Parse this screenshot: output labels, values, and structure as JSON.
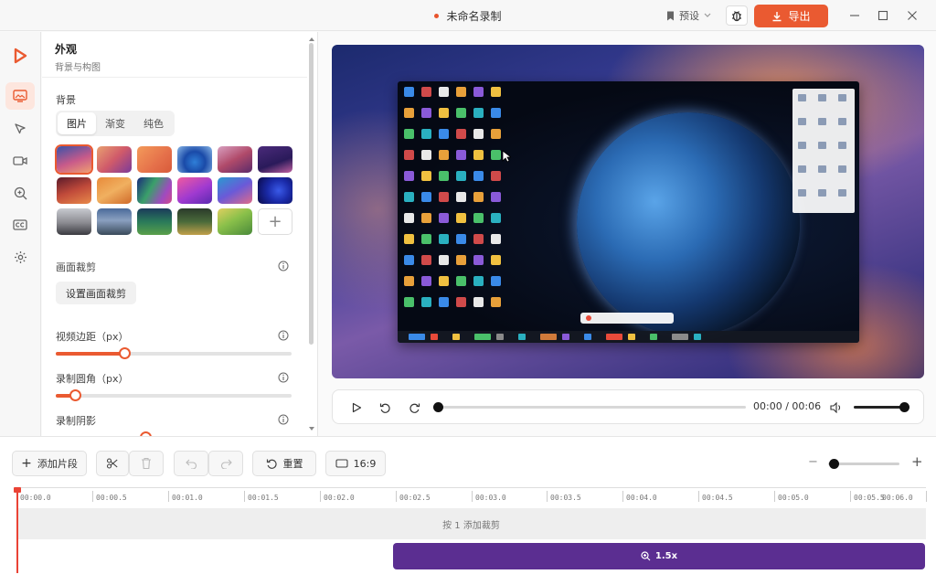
{
  "window": {
    "title": "未命名录制",
    "preset_label": "预设",
    "export_label": "导出"
  },
  "rail": {
    "items": [
      "app-logo",
      "appearance",
      "cursor",
      "camera",
      "zoom",
      "captions",
      "settings"
    ]
  },
  "panel": {
    "title": "外观",
    "subtitle": "背景与构图",
    "background_label": "背景",
    "tabs": [
      {
        "label": "图片",
        "active": true
      },
      {
        "label": "渐变",
        "active": false
      },
      {
        "label": "纯色",
        "active": false
      }
    ],
    "wallpaper_count": 17,
    "selected_wallpaper": 0,
    "crop_label": "画面裁剪",
    "crop_button": "设置画面裁剪",
    "padding_label": "视频边距（px）",
    "padding_value_fraction": 0.29,
    "radius_label": "录制圆角（px）",
    "radius_value_fraction": 0.08,
    "shadow_label": "录制阴影"
  },
  "player": {
    "time": "00:00 / 00:06",
    "progress_fraction": 0.0,
    "volume_fraction": 1.0
  },
  "toolbar": {
    "add_clip": "添加片段",
    "reset": "重置",
    "aspect_ratio": "16:9",
    "zoom_fraction": 0.05
  },
  "timeline": {
    "ticks": [
      "00:00.0",
      "00:00.5",
      "00:01.0",
      "00:01.5",
      "00:02.0",
      "00:02.5",
      "00:03.0",
      "00:03.5",
      "00:04.0",
      "00:04.5",
      "00:05.0",
      "00:05.5",
      "00:06.0"
    ],
    "cut_hint": "按 1 添加裁剪",
    "zoom_clip_label": "1.5x"
  },
  "colors": {
    "accent": "#ea5a31",
    "zoom_clip": "#5b2e91",
    "playhead": "#ea4335"
  }
}
